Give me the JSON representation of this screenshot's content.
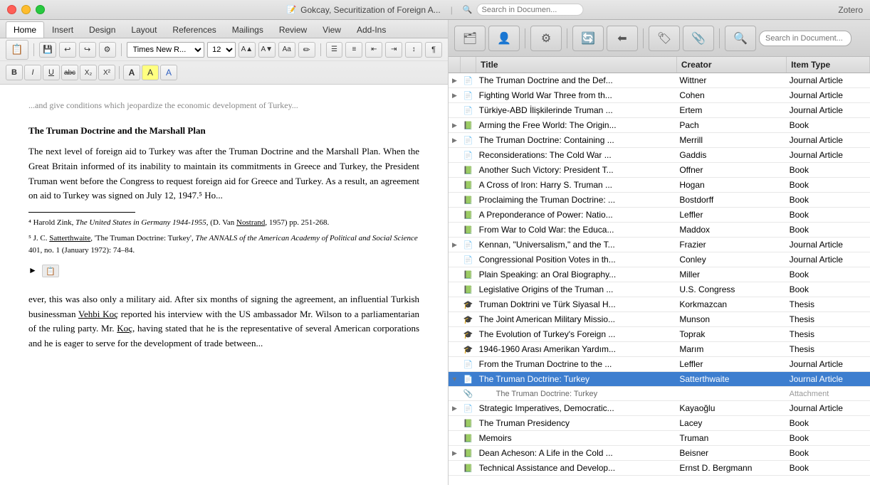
{
  "titlebar": {
    "doc_title": "Gokcay, Securitization of Foreign A...",
    "app_name": "Zotero",
    "search_placeholder": "Search in Documen..."
  },
  "word": {
    "tabs": [
      "Home",
      "Insert",
      "Design",
      "Layout",
      "References",
      "Mailings",
      "Review",
      "View",
      "Add-Ins"
    ],
    "active_tab": "Home",
    "font": "Times New R...",
    "font_size": "12",
    "toolbar_buttons_row1": [
      "↩",
      "⬜",
      "💾",
      "↩",
      "↪",
      "⚙",
      "⬅",
      "➡",
      "🔃"
    ],
    "toolbar_buttons_row2_left": [
      "B",
      "I",
      "U",
      "abc",
      "X₂",
      "X²",
      "A",
      "A",
      "A"
    ],
    "doc_fade": "...and give conditions which jeopardize the economic development of Turkey...",
    "heading": "The Truman Doctrine and the Marshall Plan",
    "para1": "The next level of foreign aid to Turkey was after the Truman Doctrine and the Marshall Plan. When the Great Britain informed of its inability to maintain its commitments in Greece and Turkey, the President Truman went before the Congress to request foreign aid for Greece and Turkey. As a result, an agreement on aid to Turkey was signed on July 12, 1947.⁵ Ho...",
    "footnote4": "⁴ Harold Zink, The United States in Germany 1944-1955, (D. Van Nostrand, 1957) pp. 251-268.",
    "footnote5": "⁵ J. C. Satterthwaite, 'The Truman Doctrine: Turkey', The ANNALS of the American Academy of Political and Social Science 401, no. 1 (January 1972): 74–84.",
    "para2_start": "ever, this was also only a military aid. After six months of signing the agreement, an influential Turkish businessman Vehbi Koç reported his interview with the US ambassador Mr. Wilson to a parliamentarian of the ruling party. Mr. Koç, having stated that he is the representative of several American corporations and he is eager to serve for the development of trade between..."
  },
  "zotero": {
    "columns": {
      "title": "Title",
      "creator": "Creator",
      "item_type": "Item Type"
    },
    "items": [
      {
        "id": 1,
        "expand": "▶",
        "type_icon": "📄",
        "title": "The Truman Doctrine and the Def...",
        "creator": "Wittner",
        "item_type": "Journal Article",
        "selected": false,
        "has_child": false,
        "is_attachment": false
      },
      {
        "id": 2,
        "expand": "▶",
        "type_icon": "📄",
        "title": "Fighting World War Three from th...",
        "creator": "Cohen",
        "item_type": "Journal Article",
        "selected": false,
        "has_child": false,
        "is_attachment": false
      },
      {
        "id": 3,
        "expand": "",
        "type_icon": "📄",
        "title": "Türkiye-ABD İlişkilerinde Truman ...",
        "creator": "Ertem",
        "item_type": "Journal Article",
        "selected": false,
        "has_child": false,
        "is_attachment": false
      },
      {
        "id": 4,
        "expand": "▶",
        "type_icon": "📗",
        "title": "Arming the Free World: The Origin...",
        "creator": "Pach",
        "item_type": "Book",
        "selected": false,
        "has_child": false,
        "is_attachment": false
      },
      {
        "id": 5,
        "expand": "▶",
        "type_icon": "📄",
        "title": "The Truman Doctrine: Containing ...",
        "creator": "Merrill",
        "item_type": "Journal Article",
        "selected": false,
        "has_child": false,
        "is_attachment": false
      },
      {
        "id": 6,
        "expand": "",
        "type_icon": "📄",
        "title": "Reconsiderations: The Cold War ...",
        "creator": "Gaddis",
        "item_type": "Journal Article",
        "selected": false,
        "has_child": false,
        "is_attachment": false
      },
      {
        "id": 7,
        "expand": "",
        "type_icon": "📗",
        "title": "Another Such Victory: President T...",
        "creator": "Offner",
        "item_type": "Book",
        "selected": false,
        "has_child": false,
        "is_attachment": false
      },
      {
        "id": 8,
        "expand": "",
        "type_icon": "📗",
        "title": "A Cross of Iron: Harry S. Truman ...",
        "creator": "Hogan",
        "item_type": "Book",
        "selected": false,
        "has_child": false,
        "is_attachment": false
      },
      {
        "id": 9,
        "expand": "",
        "type_icon": "📗",
        "title": "Proclaiming the Truman Doctrine: ...",
        "creator": "Bostdorff",
        "item_type": "Book",
        "selected": false,
        "has_child": false,
        "is_attachment": false
      },
      {
        "id": 10,
        "expand": "",
        "type_icon": "📗",
        "title": "A Preponderance of Power: Natio...",
        "creator": "Leffler",
        "item_type": "Book",
        "selected": false,
        "has_child": false,
        "is_attachment": false
      },
      {
        "id": 11,
        "expand": "",
        "type_icon": "📗",
        "title": "From War to Cold War: the Educa...",
        "creator": "Maddox",
        "item_type": "Book",
        "selected": false,
        "has_child": false,
        "is_attachment": false
      },
      {
        "id": 12,
        "expand": "▶",
        "type_icon": "📄",
        "title": "Kennan, \"Universalism,\" and the T...",
        "creator": "Frazier",
        "item_type": "Journal Article",
        "selected": false,
        "has_child": false,
        "is_attachment": false
      },
      {
        "id": 13,
        "expand": "",
        "type_icon": "📄",
        "title": "Congressional Position Votes in th...",
        "creator": "Conley",
        "item_type": "Journal Article",
        "selected": false,
        "has_child": false,
        "is_attachment": false
      },
      {
        "id": 14,
        "expand": "",
        "type_icon": "📗",
        "title": "Plain Speaking: an Oral Biography...",
        "creator": "Miller",
        "item_type": "Book",
        "selected": false,
        "has_child": false,
        "is_attachment": false
      },
      {
        "id": 15,
        "expand": "",
        "type_icon": "📗",
        "title": "Legislative Origins of the Truman ...",
        "creator": "U.S. Congress",
        "item_type": "Book",
        "selected": false,
        "has_child": false,
        "is_attachment": false
      },
      {
        "id": 16,
        "expand": "",
        "type_icon": "🎓",
        "title": "Truman Doktrini ve Türk Siyasal H...",
        "creator": "Korkmazcan",
        "item_type": "Thesis",
        "selected": false,
        "has_child": false,
        "is_attachment": false
      },
      {
        "id": 17,
        "expand": "",
        "type_icon": "🎓",
        "title": "The Joint American Military Missio...",
        "creator": "Munson",
        "item_type": "Thesis",
        "selected": false,
        "has_child": false,
        "is_attachment": false
      },
      {
        "id": 18,
        "expand": "",
        "type_icon": "🎓",
        "title": "The Evolution of Turkey's Foreign ...",
        "creator": "Toprak",
        "item_type": "Thesis",
        "selected": false,
        "has_child": false,
        "is_attachment": false
      },
      {
        "id": 19,
        "expand": "",
        "type_icon": "🎓",
        "title": "1946-1960 Arası Amerikan Yardım...",
        "creator": "Marım",
        "item_type": "Thesis",
        "selected": false,
        "has_child": false,
        "is_attachment": false
      },
      {
        "id": 20,
        "expand": "",
        "type_icon": "📄",
        "title": "From the Truman Doctrine to the ...",
        "creator": "Leffler",
        "item_type": "Journal Article",
        "selected": false,
        "has_child": false,
        "is_attachment": false
      },
      {
        "id": 21,
        "expand": "▼",
        "type_icon": "📄",
        "title": "The Truman Doctrine: Turkey",
        "creator": "Satterthwaite",
        "item_type": "Journal Article",
        "selected": true,
        "has_child": true,
        "is_attachment": false
      },
      {
        "id": 22,
        "expand": "",
        "type_icon": "📎",
        "title": "The Truman Doctrine: Turkey",
        "creator": "",
        "item_type": "Attachment",
        "selected": false,
        "has_child": false,
        "is_attachment": true
      },
      {
        "id": 23,
        "expand": "▶",
        "type_icon": "📄",
        "title": "Strategic Imperatives, Democratic...",
        "creator": "Kayaoğlu",
        "item_type": "Journal Article",
        "selected": false,
        "has_child": false,
        "is_attachment": false
      },
      {
        "id": 24,
        "expand": "",
        "type_icon": "📗",
        "title": "The Truman Presidency",
        "creator": "Lacey",
        "item_type": "Book",
        "selected": false,
        "has_child": false,
        "is_attachment": false
      },
      {
        "id": 25,
        "expand": "",
        "type_icon": "📗",
        "title": "Memoirs",
        "creator": "Truman",
        "item_type": "Book",
        "selected": false,
        "has_child": false,
        "is_attachment": false
      },
      {
        "id": 26,
        "expand": "▶",
        "type_icon": "📗",
        "title": "Dean Acheson: A Life in the Cold ...",
        "creator": "Beisner",
        "item_type": "Book",
        "selected": false,
        "has_child": false,
        "is_attachment": false
      },
      {
        "id": 27,
        "expand": "",
        "type_icon": "📗",
        "title": "Technical Assistance and Develop...",
        "creator": "Ernst D. Bergmann",
        "item_type": "Book",
        "selected": false,
        "has_child": false,
        "is_attachment": false
      }
    ]
  }
}
